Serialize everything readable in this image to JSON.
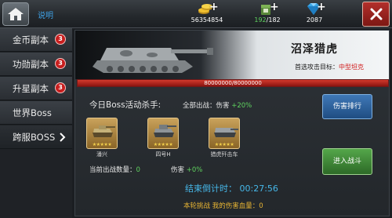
{
  "topbar": {
    "help_label": "说明",
    "resources": {
      "gold": {
        "value": "56354854",
        "icon": "gold-coins-icon"
      },
      "food": {
        "current": "192",
        "max": "/182",
        "icon": "food-supply-icon"
      },
      "gems": {
        "value": "2087",
        "icon": "diamond-icon"
      }
    }
  },
  "sidebar": {
    "items": [
      {
        "label": "金币副本",
        "badge": "3"
      },
      {
        "label": "功勋副本",
        "badge": "3"
      },
      {
        "label": "升星副本",
        "badge": "3"
      },
      {
        "label": "世界Boss"
      },
      {
        "label": "跨服BOSS"
      }
    ]
  },
  "boss": {
    "name": "沼泽猎虎",
    "target_label": "首选攻击目标：",
    "target_value": "中型坦克",
    "hp_text": "80000000/80000000",
    "hp_fraction": 1.0
  },
  "killers": {
    "title": "今日Boss活动杀手:",
    "all_out_label": "全部出战：伤害",
    "all_out_value": "+20%",
    "tanks": [
      {
        "name": "潘兴",
        "stars": "★★★★★"
      },
      {
        "name": "四号H",
        "stars": "★★★★★"
      },
      {
        "name": "猎虎歼击车",
        "stars": "★★★★★"
      }
    ]
  },
  "stats": {
    "current_label": "当前出战数量：",
    "current_value": "0",
    "damage_label": "伤害",
    "damage_value": "+0%"
  },
  "countdown": "结束倒计时：  00:27:56",
  "round_damage": "本轮挑战 我的伤害血量：0",
  "buttons": {
    "rank": "伤害排行",
    "fight": "进入战斗"
  },
  "colors": {
    "accent_blue": "#46b7e8",
    "green": "#5fd25f",
    "target_red": "#d11c1c",
    "gold": "#e8b533"
  }
}
